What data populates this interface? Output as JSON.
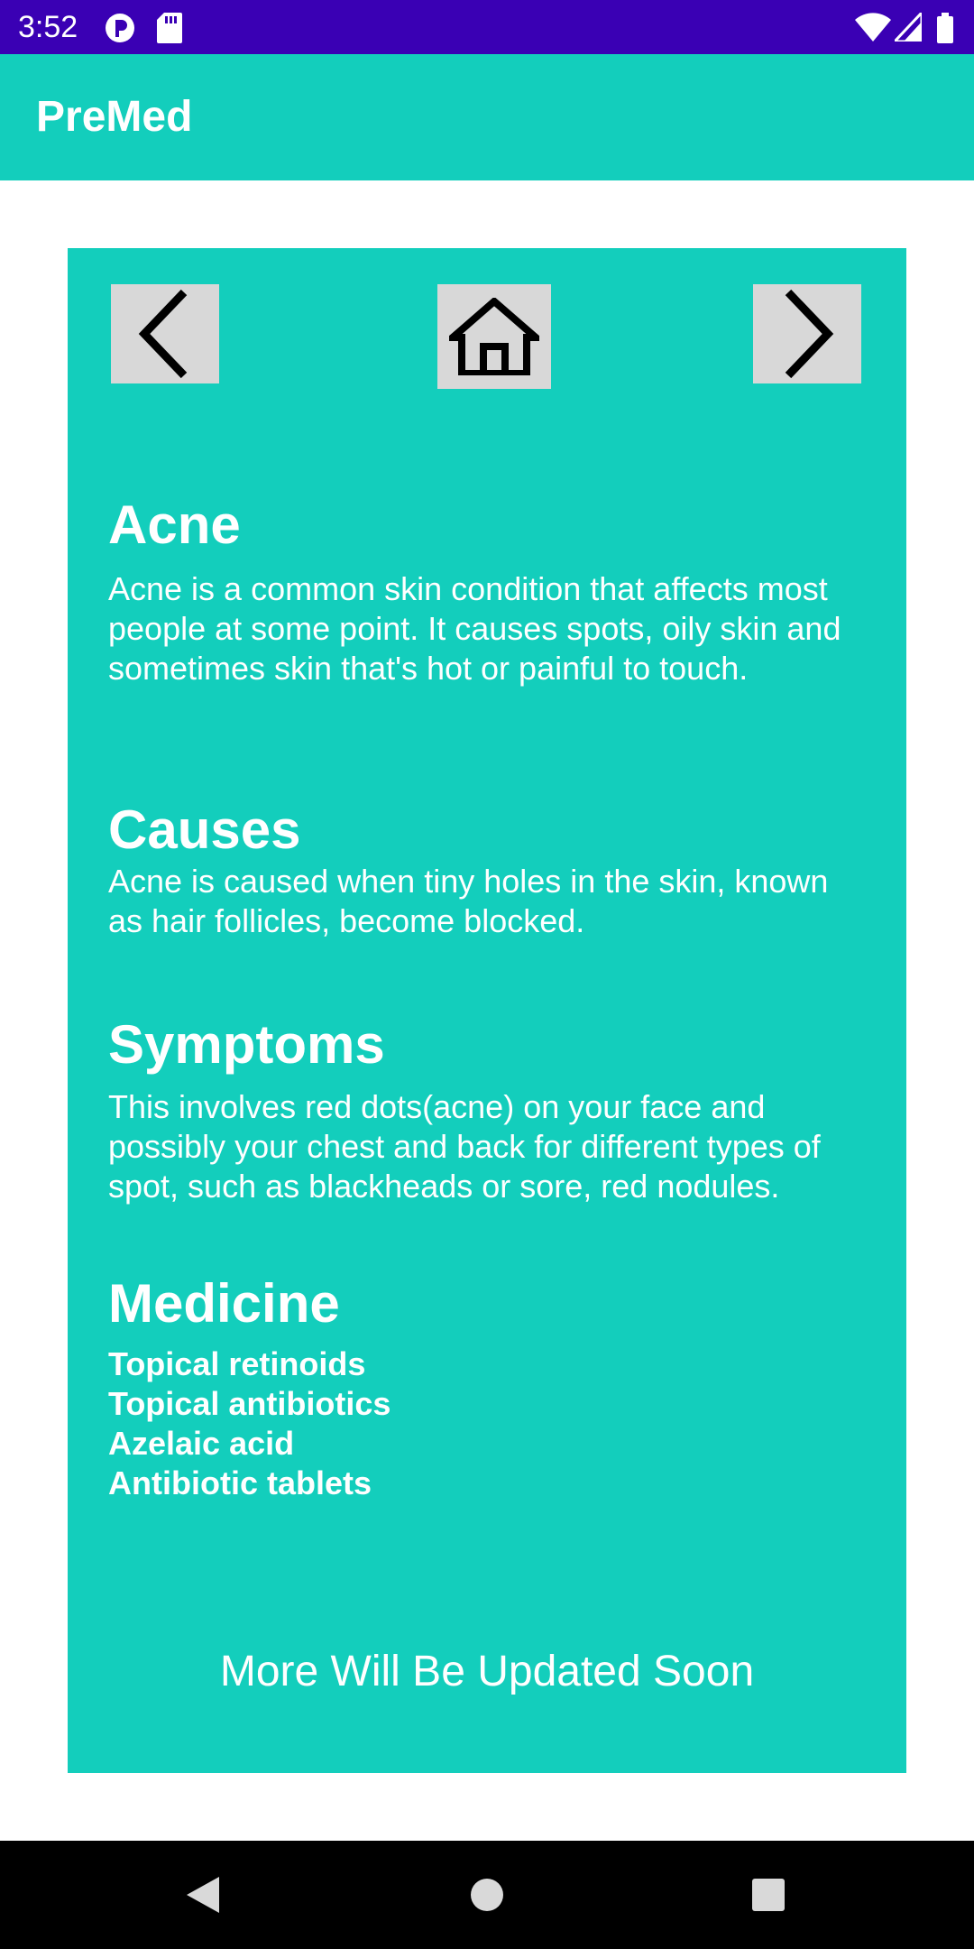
{
  "status_bar": {
    "time": "3:52"
  },
  "app_bar": {
    "title": "PreMed"
  },
  "nav": {
    "prev_icon": "chevron-left-icon",
    "home_icon": "home-icon",
    "next_icon": "chevron-right-icon"
  },
  "sections": {
    "acne": {
      "heading": "Acne",
      "body": "Acne is a common skin condition that affects most people at some point. It causes spots, oily skin and sometimes skin that's hot or painful to touch."
    },
    "causes": {
      "heading": "Causes",
      "body": "Acne is caused when tiny holes in the skin, known as hair follicles, become blocked."
    },
    "symptoms": {
      "heading": "Symptoms",
      "body": "This involves red dots(acne) on your face and possibly your chest and back for different types of spot, such as blackheads or sore, red nodules."
    },
    "medicine": {
      "heading": "Medicine",
      "items": [
        "Topical retinoids",
        "Topical antibiotics",
        "Azelaic acid",
        "Antibiotic tablets"
      ]
    }
  },
  "footer_note": "More Will Be Updated Soon",
  "colors": {
    "status_bar": "#3a00b4",
    "accent": "#13cebc",
    "button": "#d8d8d8"
  }
}
